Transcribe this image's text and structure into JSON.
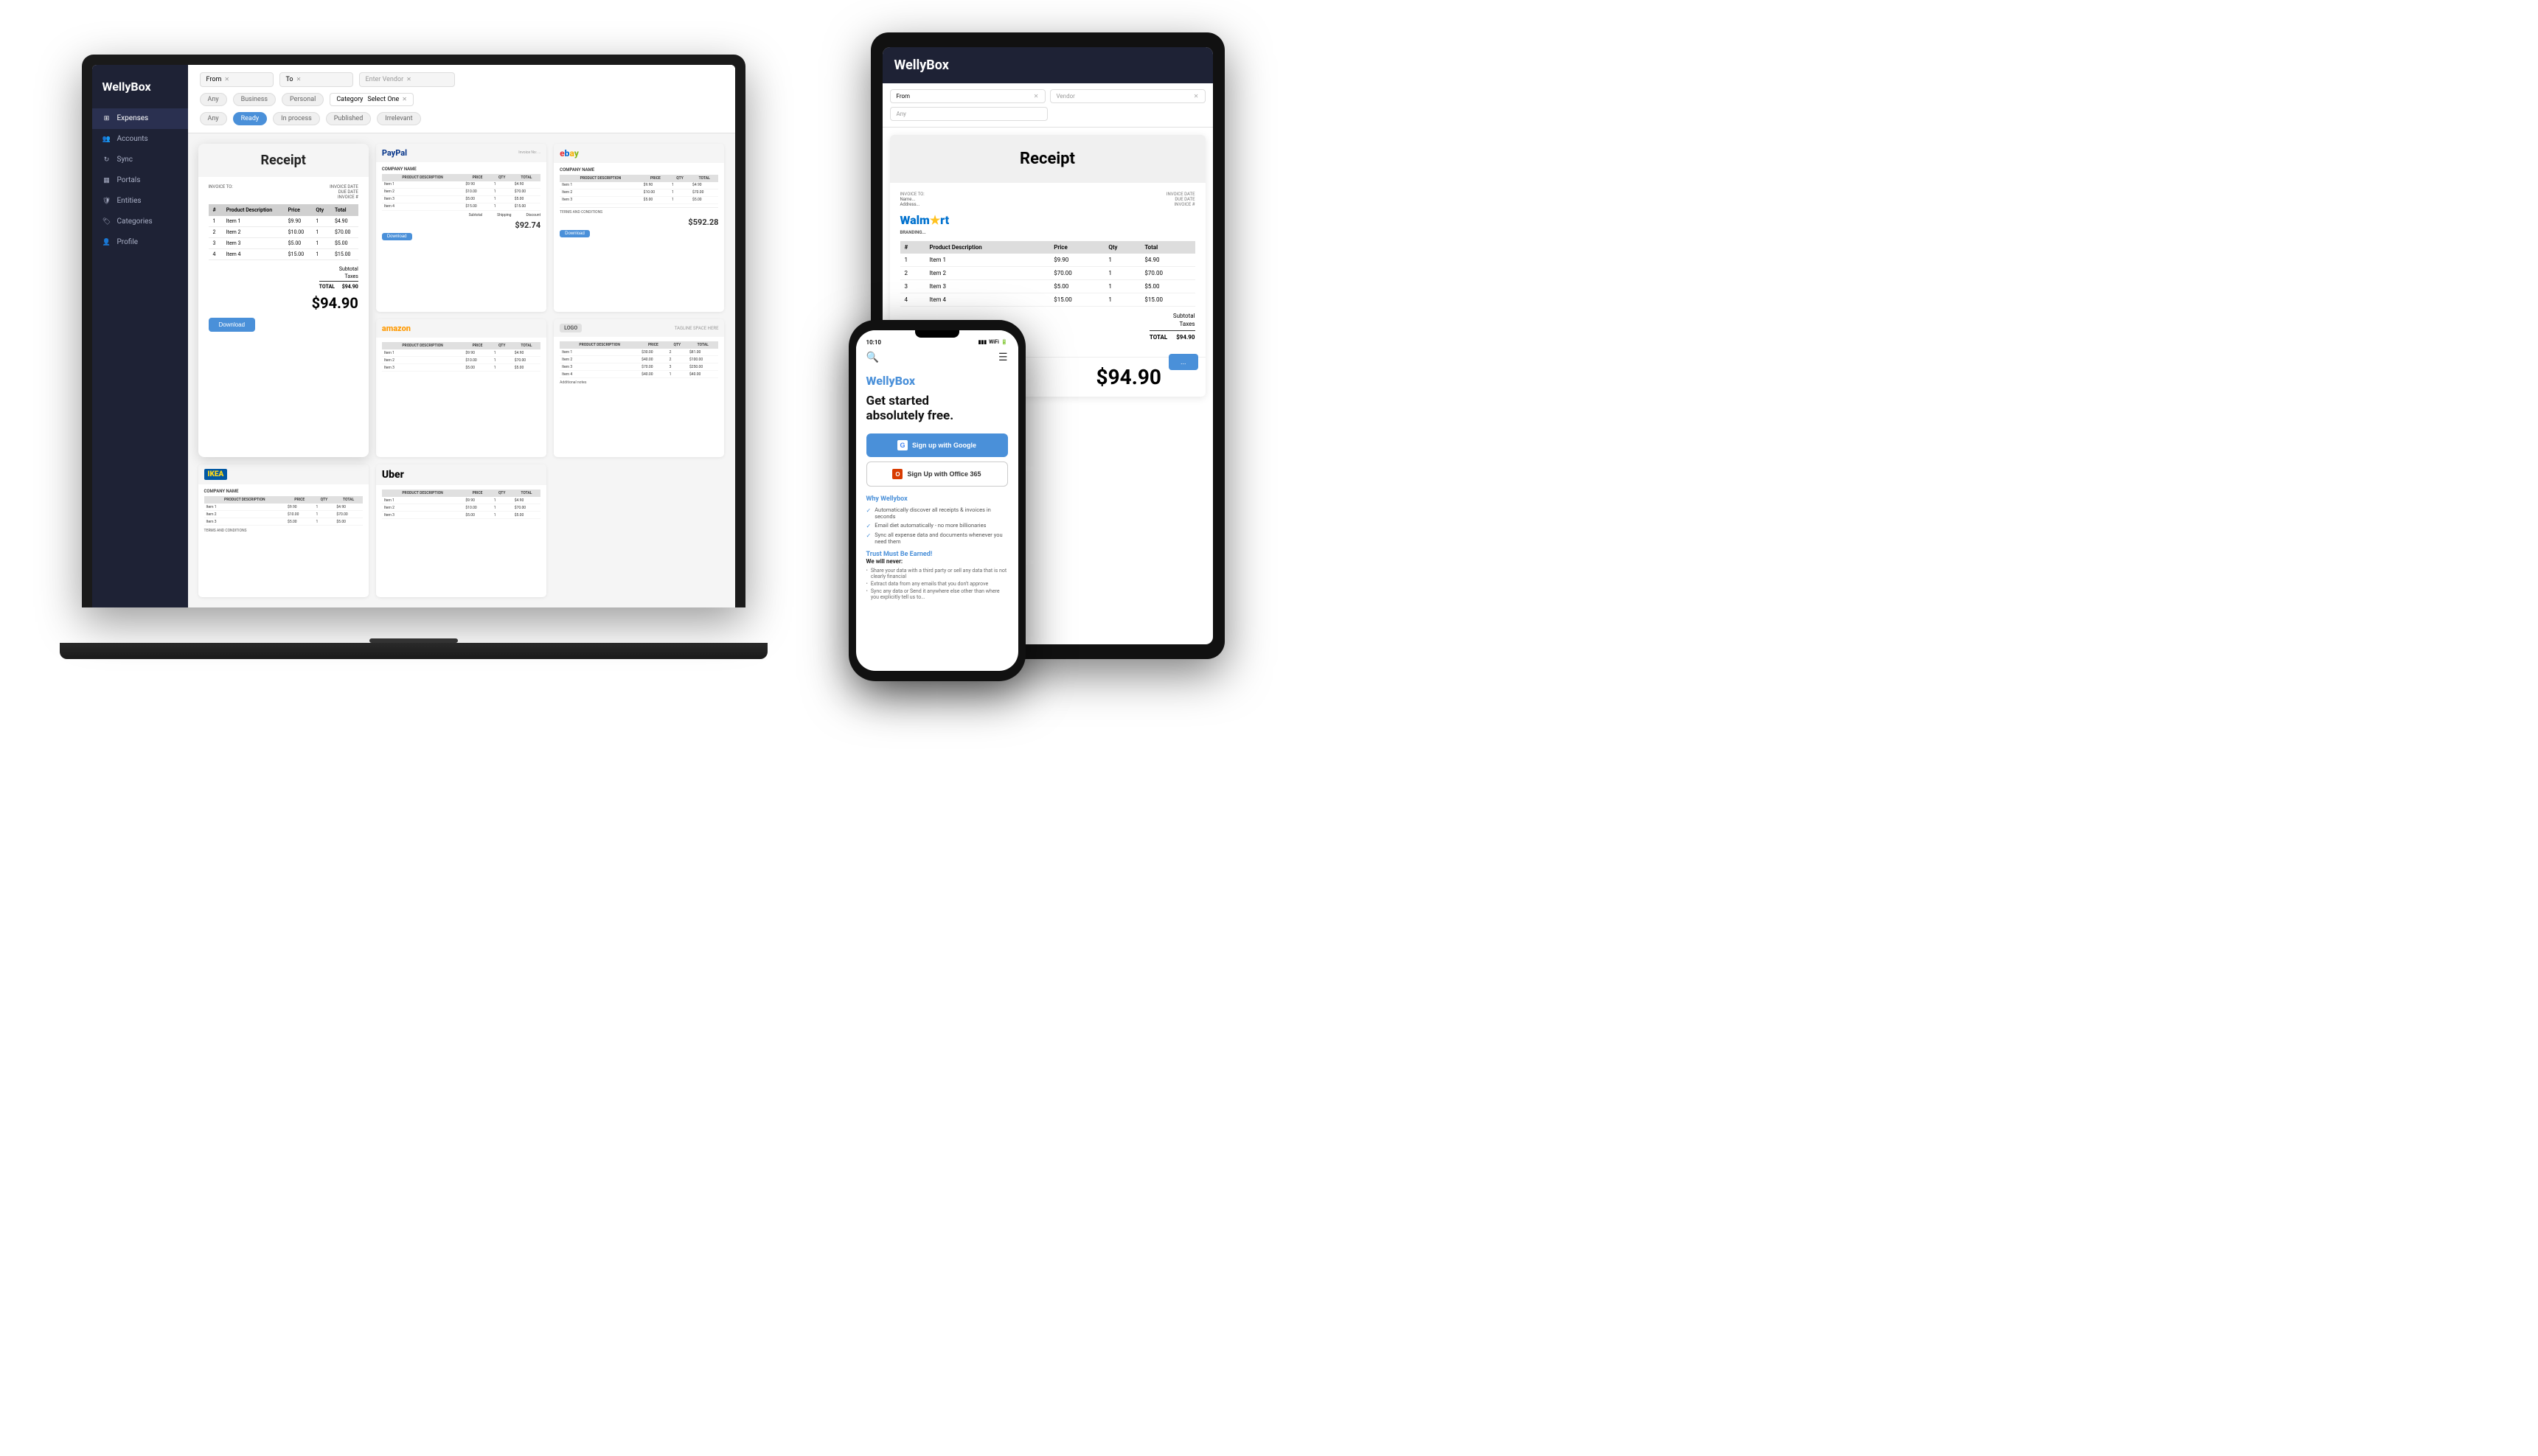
{
  "app": {
    "name": "WellyBox",
    "tagline": "Get started absolutely free."
  },
  "laptop": {
    "sidebar": {
      "logo": "WellyBox",
      "nav": [
        {
          "label": "Expenses",
          "icon": "grid"
        },
        {
          "label": "Accounts",
          "icon": "users"
        },
        {
          "label": "Sync",
          "icon": "refresh"
        },
        {
          "label": "Portals",
          "icon": "chart"
        },
        {
          "label": "Entities",
          "icon": "shield"
        },
        {
          "label": "Categories",
          "icon": "tag"
        },
        {
          "label": "Profile",
          "icon": "person"
        }
      ]
    },
    "toolbar": {
      "from_label": "From",
      "to_label": "To",
      "vendor_label": "Vendor",
      "vendor_placeholder": "Enter Vendor",
      "filters": [
        "Any",
        "Business",
        "Personal"
      ],
      "category_label": "Category",
      "category_placeholder": "Select One",
      "status_filters": [
        "Any",
        "Ready",
        "In process",
        "Published",
        "Irrelevant"
      ]
    },
    "featured_receipt": {
      "title": "Receipt",
      "company": "INVOICE TO:",
      "invoice_date_label": "INVOICE DATE",
      "due_date_label": "DUE DATE",
      "invoice_num_label": "INVOICE #",
      "table_headers": [
        "#",
        "Product Description",
        "Price",
        "Qty",
        "Total"
      ],
      "items": [
        {
          "num": 1,
          "desc": "Item 1",
          "price": "$9.90",
          "qty": 1,
          "total": "$4.90"
        },
        {
          "num": 2,
          "desc": "Item 2",
          "price": "$10.00",
          "qty": 1,
          "total": "$70.00"
        },
        {
          "num": 3,
          "desc": "Item 3",
          "price": "$5.00",
          "qty": 1,
          "total": "$5.00"
        },
        {
          "num": 4,
          "desc": "Item 4",
          "price": "$15.00",
          "qty": 1,
          "total": "$15.00"
        }
      ],
      "subtotal_label": "Subtotal",
      "taxes_label": "Taxes",
      "total_label": "TOTAL",
      "total_amount": "$94.90",
      "download_label": "Download"
    },
    "receipt_cards": [
      {
        "brand": "paypal",
        "amount": "$92.74"
      },
      {
        "brand": "ebay",
        "amount": "$592.28"
      },
      {
        "brand": "amazon",
        "amount": ""
      },
      {
        "brand": "site",
        "amount": ""
      },
      {
        "brand": "ikea",
        "amount": ""
      },
      {
        "brand": "uber",
        "amount": ""
      }
    ]
  },
  "tablet": {
    "logo": "WellyBox",
    "receipt": {
      "title": "Receipt",
      "walmart_logo": "Walmart",
      "invoice_to_label": "INVOICE TO:",
      "invoice_date_label": "INVOICE DATE",
      "due_date_label": "DUE DATE",
      "invoice_num_label": "INVOICE #",
      "table_headers": [
        "#",
        "Product Description",
        "Price",
        "Qty",
        "Total"
      ],
      "items": [
        {
          "num": 1,
          "desc": "Item 1",
          "price": "$9.90",
          "qty": 1,
          "total": "$4.90"
        },
        {
          "num": 2,
          "desc": "Item 2",
          "price": "$70.00",
          "qty": 1,
          "total": "$70.00"
        },
        {
          "num": 3,
          "desc": "Item 3",
          "price": "$5.00",
          "qty": 1,
          "total": "$5.00"
        },
        {
          "num": 4,
          "desc": "Item 4",
          "price": "$15.00",
          "qty": 1,
          "total": "$15.00"
        }
      ],
      "subtotal_label": "Subtotal",
      "taxes_label": "Taxes",
      "total_label": "TOTAL",
      "total_amount": "$94.90",
      "big_total": "$94.90"
    }
  },
  "phone": {
    "time": "10:10",
    "logo": "WellyBox",
    "tagline": "Get started\nabsolutely free.",
    "google_btn": "Sign up with Google",
    "office_btn": "Sign Up with Office 365",
    "why_title": "Why Wellybox",
    "features": [
      "Automatically discover all receipts & invoices in seconds",
      "Email diet automatically - no more billionaries",
      "Sync all expense data and documents whenever you need them"
    ],
    "trust_title": "Trust Must Be Earned!\nWe will never:",
    "trust_items": [
      "Share your data with a third party or sell any data that is not clearly financial",
      "Extract data from any emails that you don't approve",
      "Sync any data or Send it anywhere else other than where you explicitly tell us to..."
    ],
    "sign_up_google": "sign Up with Google"
  }
}
